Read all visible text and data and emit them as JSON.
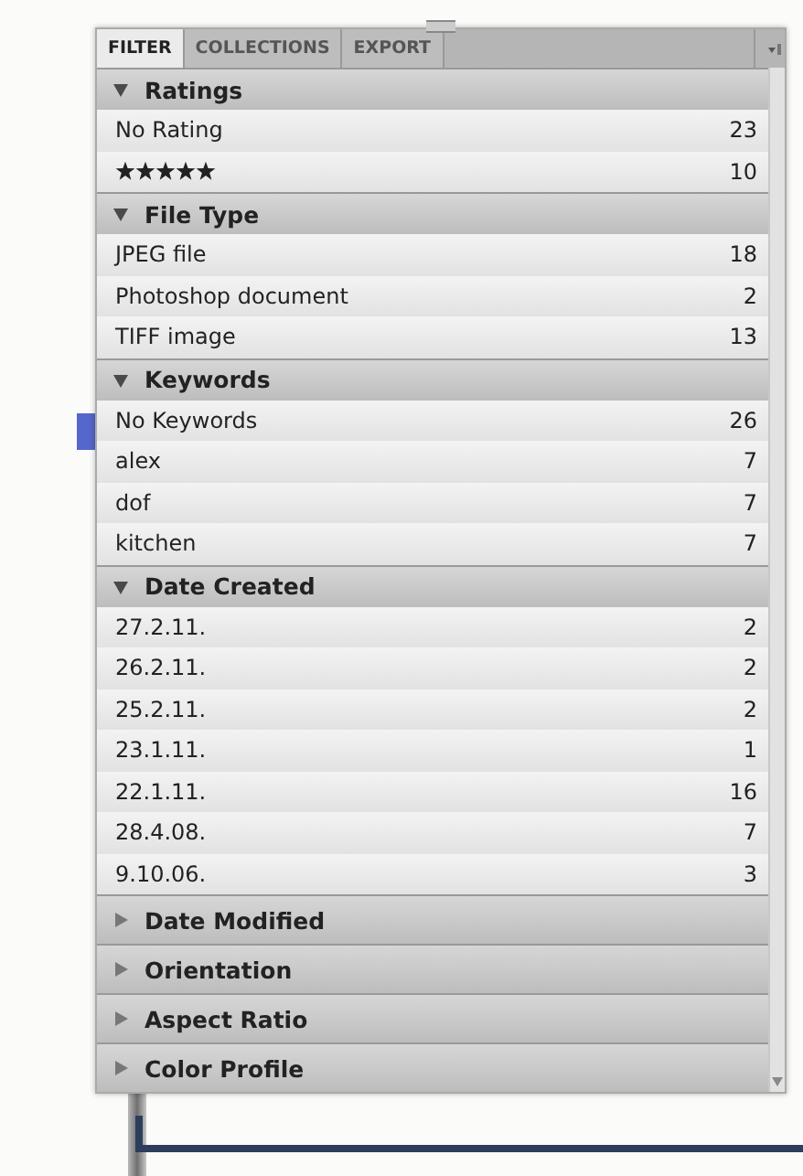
{
  "tabs": [
    {
      "label": "FILTER",
      "selected": true
    },
    {
      "label": "COLLECTIONS",
      "selected": false
    },
    {
      "label": "EXPORT",
      "selected": false
    }
  ],
  "sections": [
    {
      "title": "Ratings",
      "expanded": true,
      "items": [
        {
          "kind": "text",
          "label": "No Rating",
          "count": "23"
        },
        {
          "kind": "stars",
          "stars": 5,
          "count": "10"
        }
      ]
    },
    {
      "title": "File Type",
      "expanded": true,
      "items": [
        {
          "kind": "text",
          "label": "JPEG file",
          "count": "18"
        },
        {
          "kind": "text",
          "label": "Photoshop document",
          "count": "2"
        },
        {
          "kind": "text",
          "label": "TIFF image",
          "count": "13"
        }
      ]
    },
    {
      "title": "Keywords",
      "expanded": true,
      "items": [
        {
          "kind": "text",
          "label": "No Keywords",
          "count": "26"
        },
        {
          "kind": "text",
          "label": "alex",
          "count": "7"
        },
        {
          "kind": "text",
          "label": "dof",
          "count": "7"
        },
        {
          "kind": "text",
          "label": "kitchen",
          "count": "7"
        }
      ]
    },
    {
      "title": "Date Created",
      "expanded": true,
      "items": [
        {
          "kind": "text",
          "label": "27.2.11.",
          "count": "2"
        },
        {
          "kind": "text",
          "label": "26.2.11.",
          "count": "2"
        },
        {
          "kind": "text",
          "label": "25.2.11.",
          "count": "2"
        },
        {
          "kind": "text",
          "label": "23.1.11.",
          "count": "1"
        },
        {
          "kind": "text",
          "label": "22.1.11.",
          "count": "16"
        },
        {
          "kind": "text",
          "label": "28.4.08.",
          "count": "7"
        },
        {
          "kind": "text",
          "label": "9.10.06.",
          "count": "3"
        }
      ]
    },
    {
      "title": "Date Modified",
      "expanded": false
    },
    {
      "title": "Orientation",
      "expanded": false
    },
    {
      "title": "Aspect Ratio",
      "expanded": false
    },
    {
      "title": "Color Profile",
      "expanded": false
    }
  ]
}
